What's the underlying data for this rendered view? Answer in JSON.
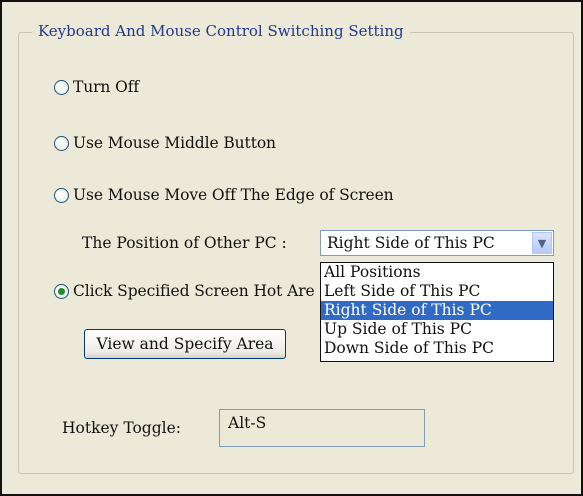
{
  "group": {
    "title": "Keyboard And Mouse Control Switching Setting"
  },
  "options": {
    "turn_off": "Turn Off",
    "middle_button": "Use Mouse Middle Button",
    "move_off_edge": "Use Mouse Move Off The Edge of Screen",
    "hot_area": "Click Specified Screen Hot Are"
  },
  "position": {
    "label": "The Position of Other PC :",
    "selected": "Right Side of This PC",
    "options": [
      "All Positions",
      "Left Side of This PC",
      "Right Side of This PC",
      "Up Side of This PC",
      "Down Side of This PC"
    ]
  },
  "buttons": {
    "view_area": "View and Specify Area"
  },
  "hotkey": {
    "label": "Hotkey Toggle:",
    "value": "Alt-S"
  }
}
